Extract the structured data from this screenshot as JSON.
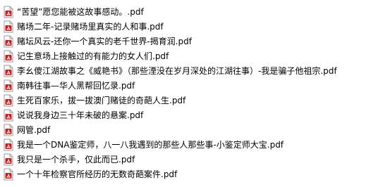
{
  "colors": {
    "background": "#ffffff",
    "text": "#000000",
    "icon_page": "#ffffff",
    "icon_border": "#9a9a9a",
    "icon_badge": "#cc1d1d"
  },
  "icons": {
    "file_type": "pdf-file-icon"
  },
  "files": [
    {
      "name": "“苦望”愿您能被这故事感动。.pdf"
    },
    {
      "name": "赌场二年-记录赌场里真实的人和事.pdf"
    },
    {
      "name": "赌坛风云-还你一个真实的老千世界-揭育润.pdf"
    },
    {
      "name": "记生意场上接触过的有能力的女人们.pdf"
    },
    {
      "name": "李幺傻江湖故事之《威艳书》（那些湮没在岁月深处的江湖往事）-我是骗子他祖宗.pdf"
    },
    {
      "name": "南韩往事—华人黑帮回忆录.pdf"
    },
    {
      "name": "生死百家乐，拔一拔澳门赌徒的奇葩人生.pdf"
    },
    {
      "name": "说说我身边三十年未破的悬案.pdf"
    },
    {
      "name": "网管.pdf"
    },
    {
      "name": "我是一个DNA鉴定师，八一八我遇到的那些人那些事-小鉴定师大宝.pdf"
    },
    {
      "name": "我只是一个杀手，仅此而已.pdf"
    },
    {
      "name": "一个十年检察官所经历的无数奇葩案件.pdf"
    }
  ]
}
